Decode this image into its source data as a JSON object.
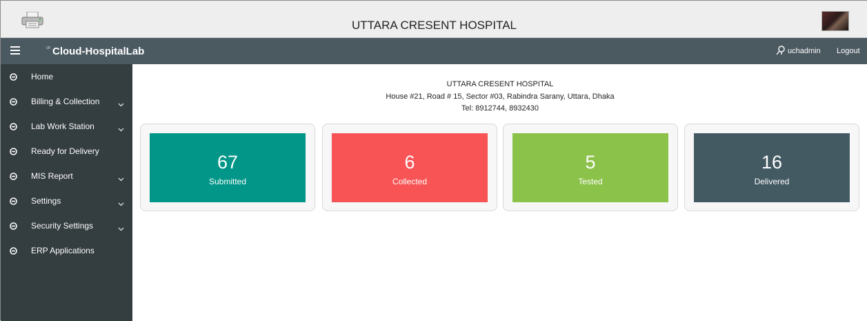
{
  "topbar": {
    "title": "UTTARA CRESENT HOSPITAL"
  },
  "navbar": {
    "brand_mark": "ch",
    "brand": "Cloud-HospitalLab",
    "username": "uchadmin",
    "logout": "Logout"
  },
  "sidebar": {
    "items": [
      {
        "label": "Home",
        "has_submenu": false
      },
      {
        "label": "Billing & Collection",
        "has_submenu": true
      },
      {
        "label": "Lab Work Station",
        "has_submenu": true
      },
      {
        "label": "Ready for Delivery",
        "has_submenu": false
      },
      {
        "label": "MIS Report",
        "has_submenu": true
      },
      {
        "label": "Settings",
        "has_submenu": true
      },
      {
        "label": "Security Settings",
        "has_submenu": true
      },
      {
        "label": "ERP Applications",
        "has_submenu": false
      }
    ]
  },
  "hospital": {
    "name": "UTTARA CRESENT HOSPITAL",
    "address": "House #21, Road # 15, Sector #03, Rabindra Sarany, Uttara, Dhaka",
    "tel": "Tel: 8912744, 8932430"
  },
  "stats": [
    {
      "value": "67",
      "label": "Submitted",
      "color": "#019688"
    },
    {
      "value": "6",
      "label": "Collected",
      "color": "#f85455"
    },
    {
      "value": "5",
      "label": "Tested",
      "color": "#8bc24a"
    },
    {
      "value": "16",
      "label": "Delivered",
      "color": "#445a63"
    }
  ],
  "colors": {
    "sidebar_bg": "#343d40",
    "navbar_bg": "#4b5a61",
    "topbar_bg": "#eeeeee"
  },
  "icons": {
    "printer": "printer-icon",
    "menu": "hamburger-menu-icon",
    "user": "user-icon",
    "bullet": "circle-dot-icon",
    "chevron": "chevron-down-icon"
  }
}
